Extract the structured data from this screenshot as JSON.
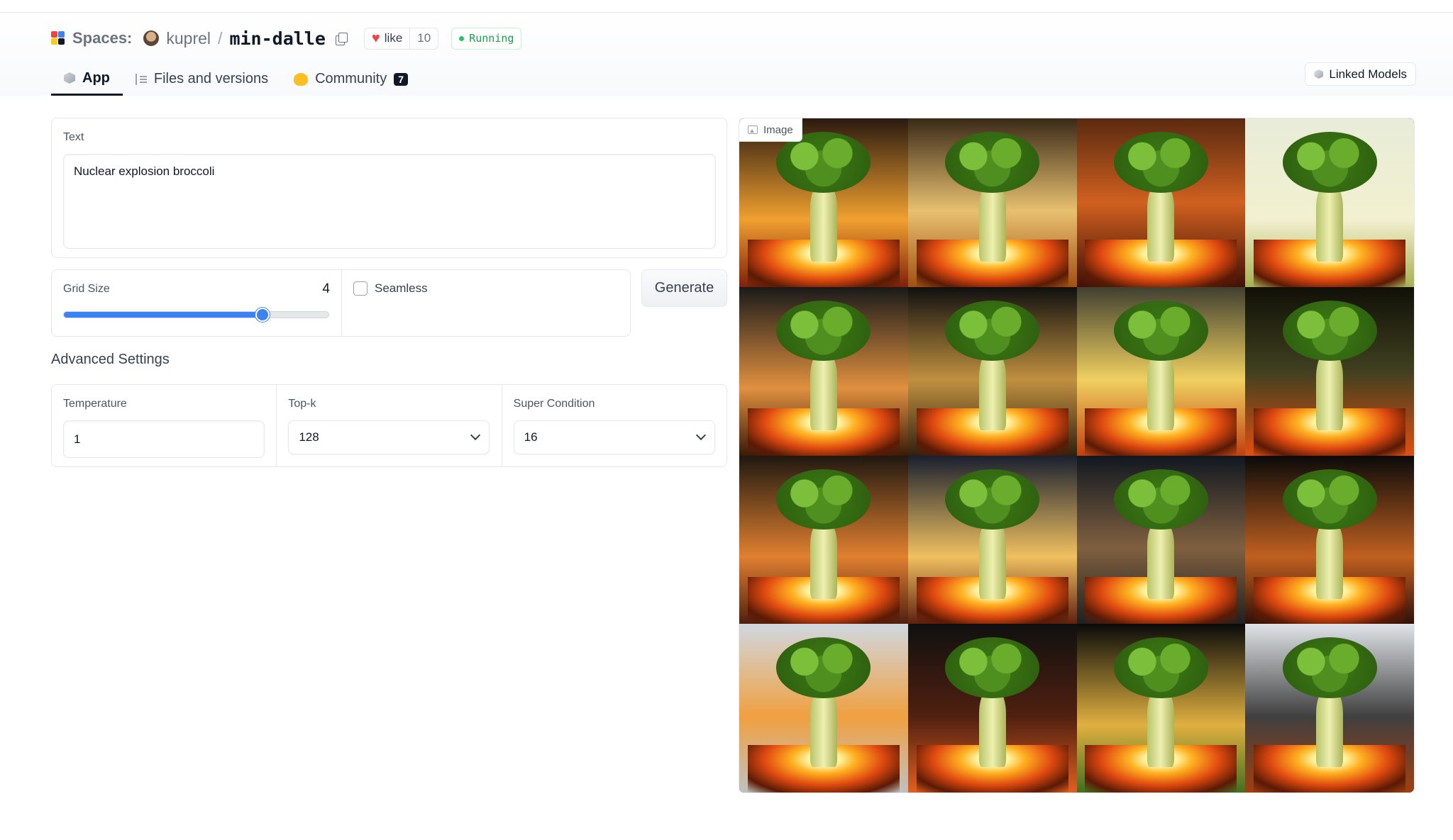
{
  "header": {
    "spaces_label": "Spaces:",
    "owner": "kuprel",
    "separator": "/",
    "repo": "min-dalle",
    "like_label": "like",
    "like_count": "10",
    "status": "Running",
    "status_color": "#16a34a"
  },
  "tabs": [
    {
      "label": "App",
      "icon": "cube-icon",
      "active": true
    },
    {
      "label": "Files and versions",
      "icon": "files-icon",
      "active": false
    },
    {
      "label": "Community",
      "icon": "community-icon",
      "badge": "7",
      "active": false
    }
  ],
  "linked_models_label": "Linked Models",
  "form": {
    "text_label": "Text",
    "text_value": "Nuclear explosion broccoli",
    "grid_size_label": "Grid Size",
    "grid_size_value": "4",
    "grid_size_fraction": 0.75,
    "seamless_label": "Seamless",
    "seamless_checked": false,
    "generate_label": "Generate",
    "advanced_title": "Advanced Settings",
    "temperature_label": "Temperature",
    "temperature_value": "1",
    "topk_label": "Top-k",
    "topk_value": "128",
    "super_condition_label": "Super Condition",
    "super_condition_value": "16"
  },
  "output": {
    "image_label": "Image",
    "image_icon": "image-icon",
    "grid_tiles": 16,
    "accent_color": "#3b82f6"
  }
}
